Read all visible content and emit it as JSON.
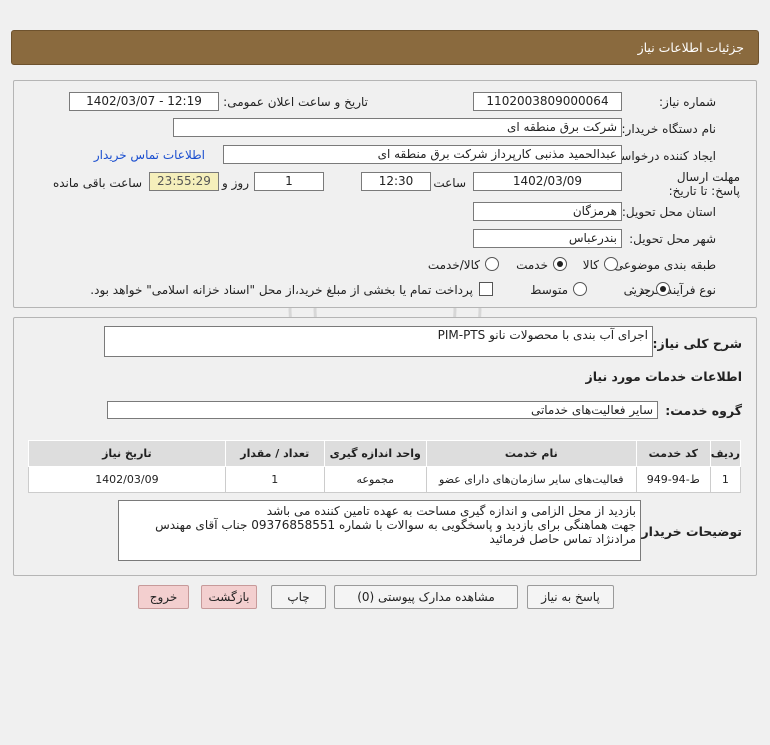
{
  "header": {
    "title": "جزئیات اطلاعات نیاز"
  },
  "form": {
    "need_number_label": "شماره نیاز:",
    "need_number": "1102003809000064",
    "announce_label": "تاریخ و ساعت اعلان عمومی:",
    "announce_value": "1402/03/07 - 12:19",
    "buyer_org_label": "نام دستگاه خریدار:",
    "buyer_org": "شرکت برق منطقه ای",
    "creator_label": "ایجاد کننده درخواست:",
    "creator": "عبدالحمید  مذنبی کارپرداز شرکت برق منطقه ای",
    "contact_link": "اطلاعات تماس خریدار",
    "deadline_label": "مهلت ارسال پاسخ: تا تاریخ:",
    "deadline_date": "1402/03/09",
    "time_label": "ساعت",
    "deadline_time": "12:30",
    "days_value": "1",
    "days_label": "روز و",
    "remaining_time": "23:55:29",
    "remaining_label": "ساعت باقی مانده",
    "province_label": "استان محل تحویل:",
    "province": "هرمزگان",
    "city_label": "شهر محل تحویل:",
    "city": "بندرعباس",
    "category_label": "طبقه بندی موضوعی:",
    "category_options": [
      "کالا",
      "خدمت",
      "کالا/خدمت"
    ],
    "category_selected": 1,
    "process_label": "نوع فرآیند خرید :",
    "process_options": [
      "جزیی",
      "متوسط"
    ],
    "process_selected": 0,
    "payment_note": "پرداخت تمام یا بخشی از مبلغ خرید،از محل \"اسناد خزانه اسلامی\" خواهد بود."
  },
  "details": {
    "summary_label": "شرح کلی نیاز:",
    "summary": "اجرای آب بندی با محصولات نانو PIM-PTS",
    "services_title": "اطلاعات خدمات مورد نیاز",
    "service_group_label": "گروه خدمت:",
    "service_group": "سایر فعالیت‌های خدماتی",
    "table": {
      "headers": [
        "ردیف",
        "کد خدمت",
        "نام خدمت",
        "واحد اندازه گیری",
        "تعداد / مقدار",
        "تاریخ نیاز"
      ],
      "rows": [
        [
          "1",
          "ط-94-949",
          "فعالیت‌های سایر سازمان‌های دارای عضو",
          "مجموعه",
          "1",
          "1402/03/09"
        ]
      ]
    },
    "buyer_notes_label": "توضیحات خریدار:",
    "buyer_notes": [
      "بازدید از محل الزامی و اندازه گیری مساحت به عهده تامین کننده می باشد",
      "جهت هماهنگی برای بازدید و پاسخگویی به سوالات با شماره 09376858551 جناب آقای مهندس",
      "مرادنژاد تماس حاصل فرمائید"
    ]
  },
  "buttons": {
    "reply": "پاسخ به نیاز",
    "attachments": "مشاهده مدارک پیوستی (0)",
    "print": "چاپ",
    "back": "بازگشت",
    "exit": "خروج"
  }
}
